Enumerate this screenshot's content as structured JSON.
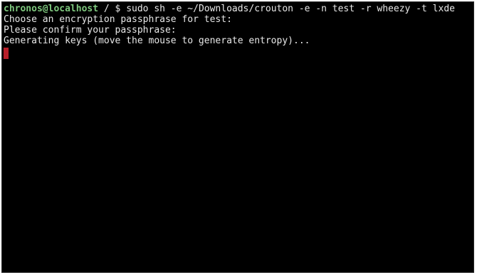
{
  "terminal": {
    "prompt_user": "chronos@localhost",
    "prompt_rest": " / $ sudo sh -e ~/Downloads/crouton -e -n test -r wheezy -t lxde",
    "output_lines": [
      "Choose an encryption passphrase for test:",
      "Please confirm your passphrase:",
      "Generating keys (move the mouse to generate entropy)..."
    ]
  },
  "colors": {
    "background": "#000000",
    "text": "#e8e8e8",
    "prompt_user": "#7fc97f",
    "cursor": "#b81f2a"
  }
}
